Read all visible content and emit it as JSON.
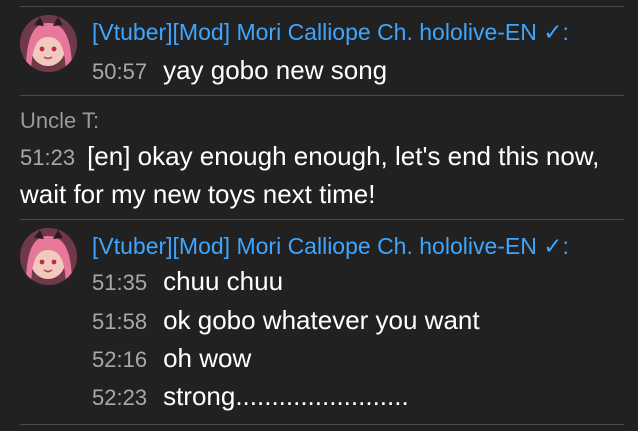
{
  "messages": [
    {
      "author": "[Vtuber][Mod] Mori Calliope Ch. hololive-EN ✓:",
      "lines": [
        {
          "time": "50:57",
          "text": "yay gobo new song"
        }
      ]
    },
    {
      "author": "Uncle T:",
      "lines": [
        {
          "time": "51:23",
          "text": "[en] okay enough enough, let's end this now, wait for my new toys next time!"
        }
      ]
    },
    {
      "author": "[Vtuber][Mod] Mori Calliope Ch. hololive-EN ✓:",
      "lines": [
        {
          "time": "51:35",
          "text": "chuu chuu"
        },
        {
          "time": "51:58",
          "text": "ok gobo whatever you want"
        },
        {
          "time": "52:16",
          "text": "oh wow"
        },
        {
          "time": "52:23",
          "text": "strong........................"
        }
      ]
    }
  ],
  "colors": {
    "background": "#212121",
    "moderator_name": "#3ea6ff",
    "user_name": "#9a9a9a",
    "timestamp": "#a8a8a8",
    "message": "#ffffff",
    "divider": "#4a4a4a"
  },
  "icons": {
    "avatar": "avatar-image"
  }
}
